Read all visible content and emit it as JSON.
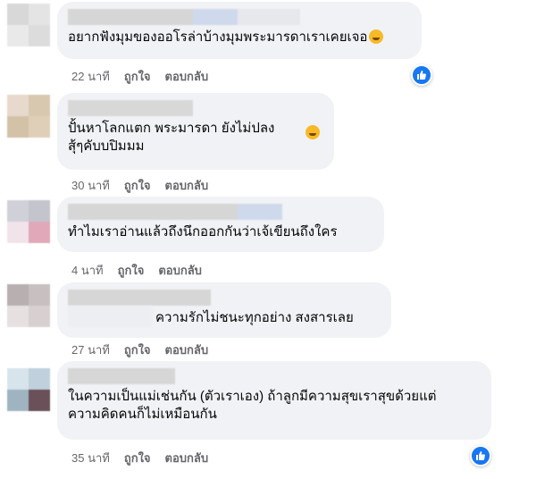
{
  "comments": [
    {
      "text": "อยากฟังมุมของออโรล่าบ้างมุมพระมารดาเราเคยเจอ",
      "has_emoji": true,
      "time": "22 นาที",
      "like_label": "ถูกใจ",
      "reply_label": "ตอบกลับ",
      "reaction": "like-icon"
    },
    {
      "text": "ปั้นหาโลกแตก พระมารดา ยังไม่ปลง\nสุ้ๆคับบปิมมม",
      "has_emoji": true,
      "time": "30 นาที",
      "like_label": "ถูกใจ",
      "reply_label": "ตอบกลับ"
    },
    {
      "text": "ทำไมเราอ่านแล้วถึงนึกออกกันว่าเจ้เขียนถึงใคร",
      "time": "4 นาที",
      "like_label": "ถูกใจ",
      "reply_label": "ตอบกลับ"
    },
    {
      "text": "ความรักไม่ชนะทุกอย่าง สงสารเลย",
      "time": "27 นาที",
      "like_label": "ถูกใจ",
      "reply_label": "ตอบกลับ"
    },
    {
      "text": "ในความเป็นแม่เช่นกัน (ตัวเราเอง) ถ้าลูกมีความสุขเราสุขด้วยแต่\nความคิดคนก็ไม่เหมือนกัน",
      "time": "35 นาที",
      "like_label": "ถูกใจ",
      "reply_label": "ตอบกลับ",
      "reaction": "like-icon"
    }
  ]
}
